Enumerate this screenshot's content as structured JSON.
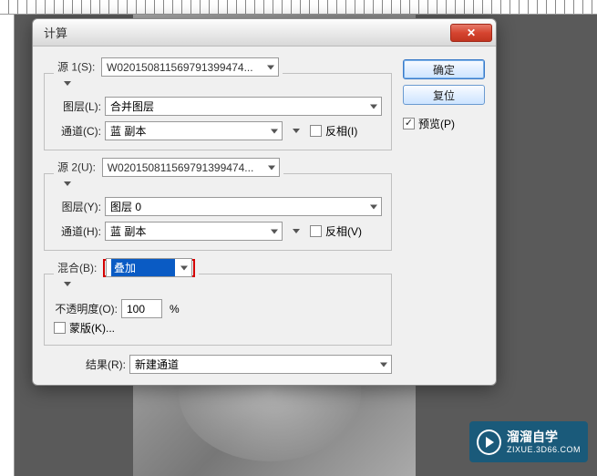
{
  "dialog": {
    "title": "计算",
    "source1": {
      "legend": "源 1(S):",
      "value": "W020150811569791399474...",
      "layer_label": "图层(L):",
      "layer_value": "合并图层",
      "channel_label": "通道(C):",
      "channel_value": "蓝 副本",
      "invert_label": "反相(I)"
    },
    "source2": {
      "legend": "源 2(U):",
      "value": "W020150811569791399474...",
      "layer_label": "图层(Y):",
      "layer_value": "图层 0",
      "channel_label": "通道(H):",
      "channel_value": "蓝 副本",
      "invert_label": "反相(V)"
    },
    "blend": {
      "label": "混合(B):",
      "value": "叠加"
    },
    "opacity": {
      "label": "不透明度(O):",
      "value": "100",
      "unit": "%"
    },
    "mask": {
      "label": "蒙版(K)..."
    },
    "result": {
      "label": "结果(R):",
      "value": "新建通道"
    },
    "buttons": {
      "ok": "确定",
      "reset": "复位",
      "preview": "预览(P)"
    }
  },
  "watermark": {
    "title": "溜溜自学",
    "url": "ZIXUE.3D66.COM"
  }
}
